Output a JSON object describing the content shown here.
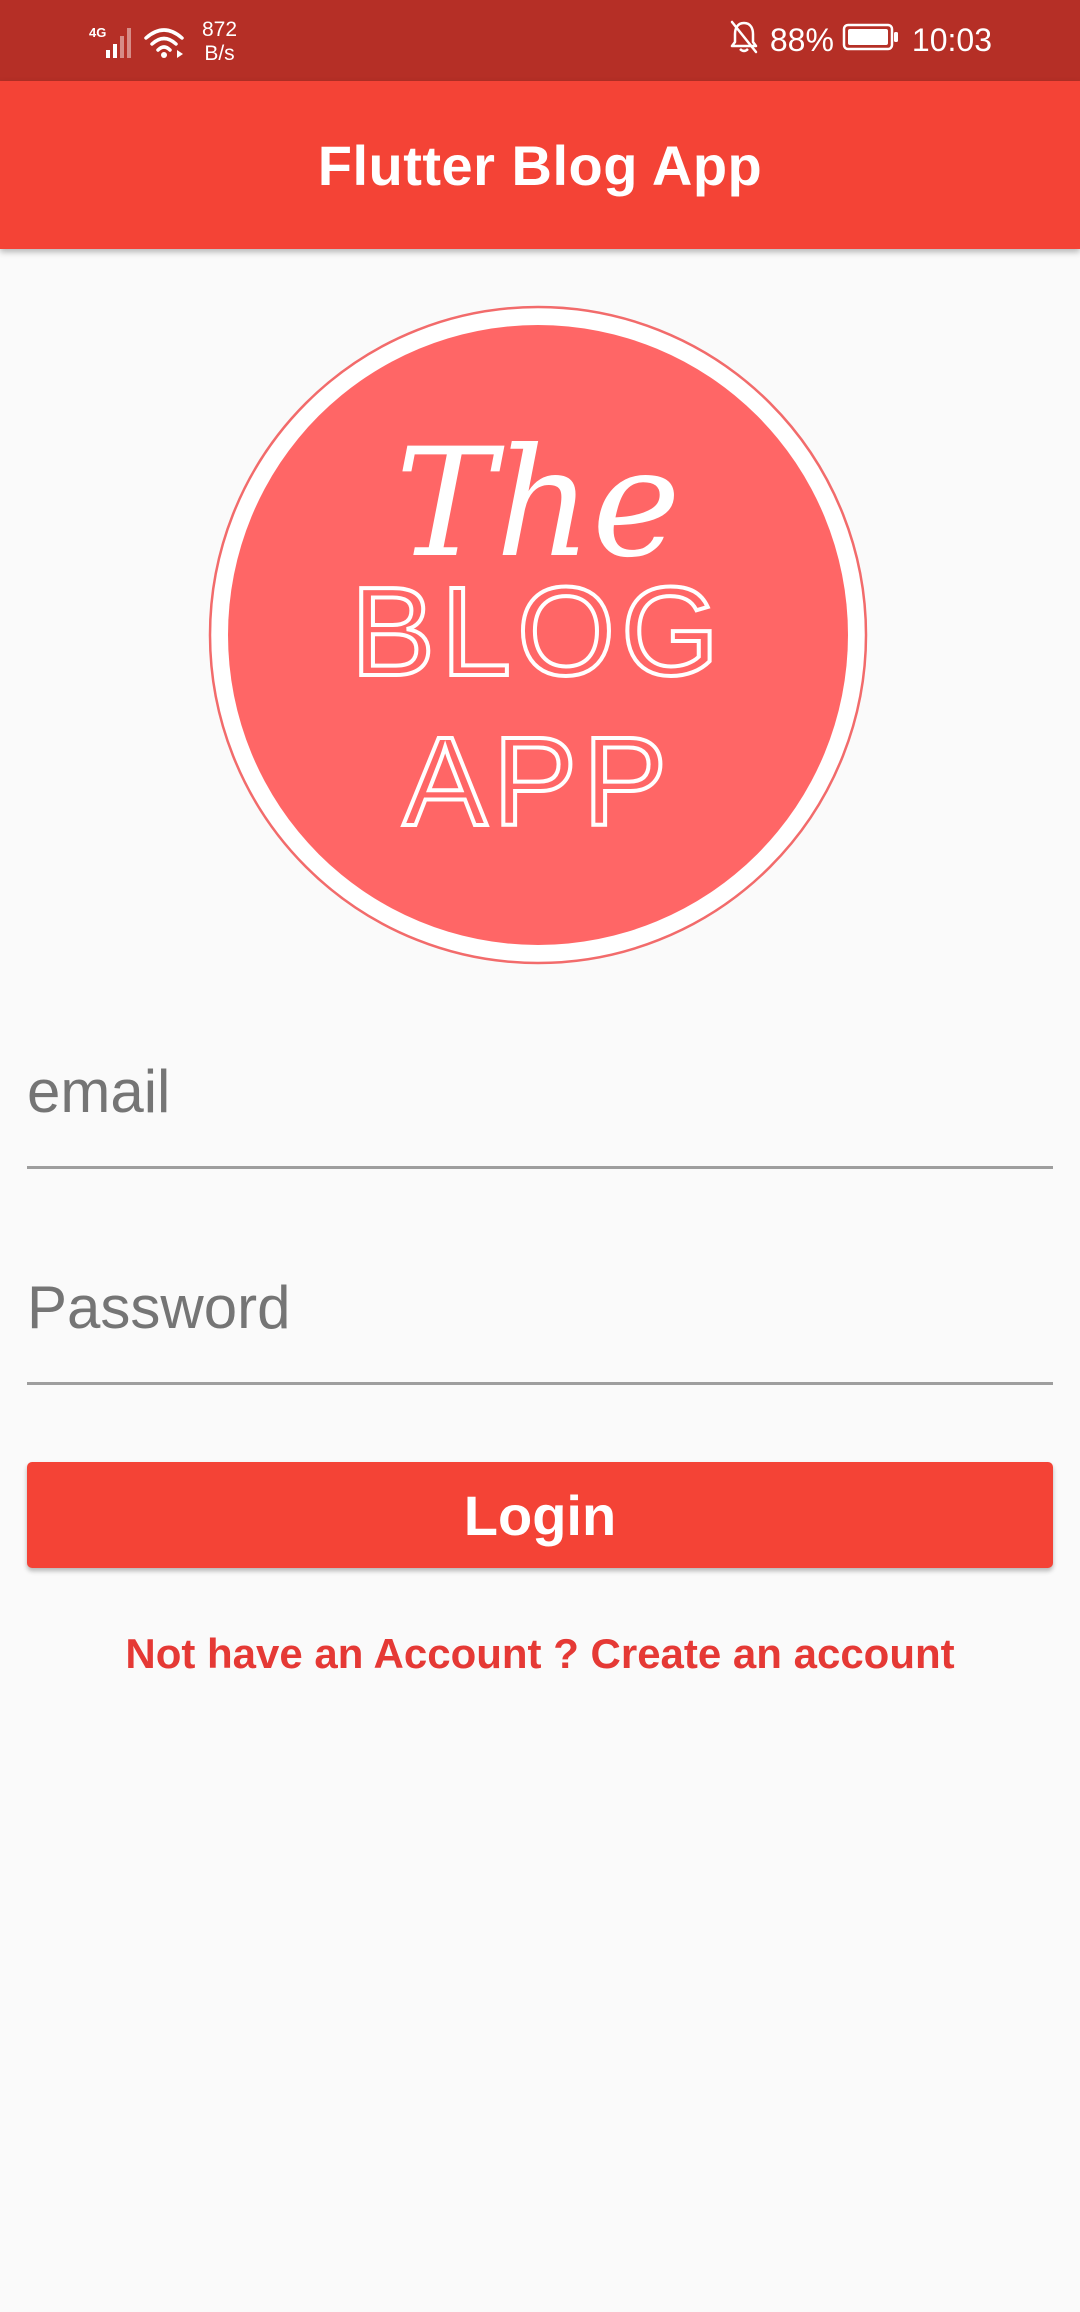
{
  "status_bar": {
    "network_type": "4G",
    "net_speed_value": "872",
    "net_speed_unit": "B/s",
    "battery_percent": "88%",
    "time": "10:03",
    "icons": [
      "signal-icon",
      "wifi-icon",
      "bell-off-icon",
      "battery-icon"
    ]
  },
  "app_bar": {
    "title": "Flutter Blog App"
  },
  "logo": {
    "line1": "The",
    "line2": "BLOG",
    "line3": "APP",
    "fill_color": "#ff6666"
  },
  "form": {
    "email_placeholder": "email",
    "email_value": "",
    "password_placeholder": "Password",
    "password_value": ""
  },
  "login_button": {
    "label": "Login"
  },
  "signup_link": {
    "text": "Not have an Account ? Create an account"
  },
  "colors": {
    "status_bar": "#b52f26",
    "primary": "#f44336",
    "link": "#e53935",
    "background": "#fafafa"
  }
}
